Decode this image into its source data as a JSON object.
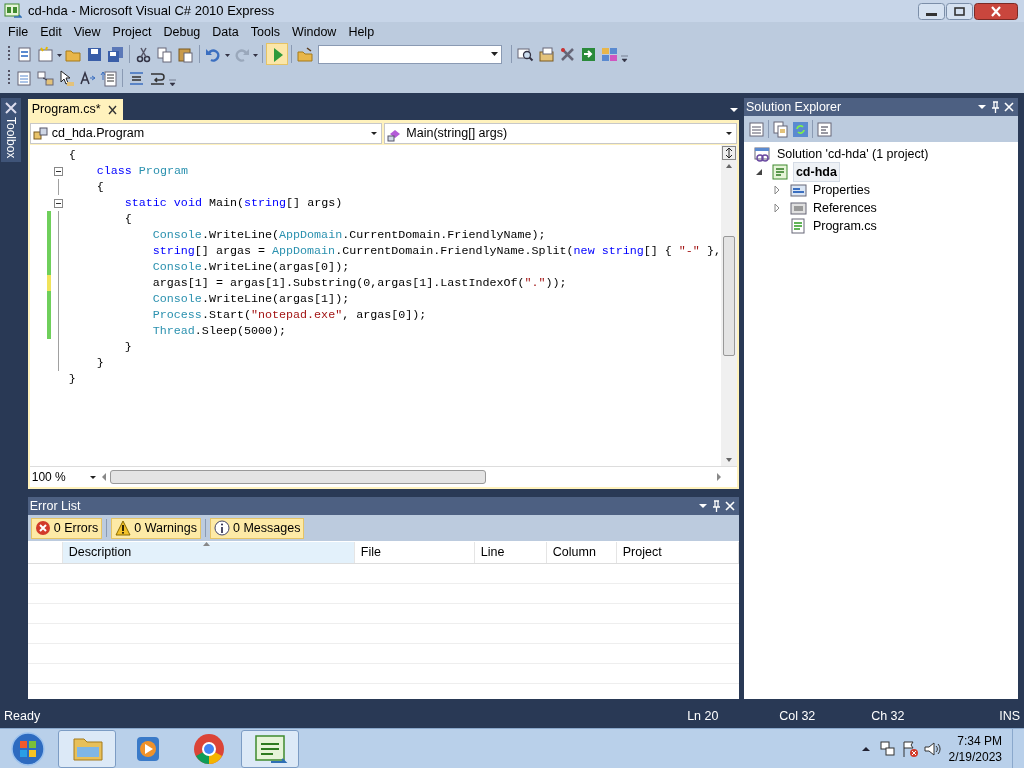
{
  "window": {
    "title": "cd-hda - Microsoft Visual C# 2010 Express"
  },
  "menu": [
    "File",
    "Edit",
    "View",
    "Project",
    "Debug",
    "Data",
    "Tools",
    "Window",
    "Help"
  ],
  "toolbox_tab": "Toolbox",
  "editor": {
    "tabs": [
      {
        "label": "Program.cs*",
        "selected": true
      }
    ],
    "type_dropdown": "cd_hda.Program",
    "member_dropdown": "Main(string[] args)",
    "lines": [
      {
        "modified": false,
        "fold": false,
        "tokens": [
          {
            "kind": "plain",
            "text": "{"
          }
        ],
        "children": [
          {
            "modified": false,
            "fold": true,
            "tokens": [
              {
                "kind": "keyword",
                "text": "class"
              },
              {
                "kind": "type",
                "text": " Program"
              }
            ]
          },
          {
            "modified": false,
            "fold": false,
            "tokens": [
              {
                "kind": "plain",
                "text": "{"
              }
            ],
            "children": [
              {
                "modified": false,
                "fold": true,
                "tokens": [
                  {
                    "kind": "keyword",
                    "text": "static void"
                  },
                  {
                    "kind": "plain",
                    "text": " Main("
                  },
                  {
                    "kind": "keyword",
                    "text": "string"
                  },
                  {
                    "kind": "plain",
                    "text": "[] args)"
                  }
                ]
              },
              {
                "modified": true,
                "saved": true,
                "fold": false,
                "tokens": [
                  {
                    "kind": "plain",
                    "text": "{"
                  }
                ],
                "children": [
                  {
                    "modified": true,
                    "saved": true,
                    "fold": false,
                    "tokens": [
                      {
                        "kind": "type",
                        "text": "Console"
                      },
                      {
                        "kind": "plain",
                        "text": ".WriteLine("
                      },
                      {
                        "kind": "type",
                        "text": "AppDomain"
                      },
                      {
                        "kind": "plain",
                        "text": ".CurrentDomain.FriendlyName);"
                      }
                    ]
                  },
                  {
                    "modified": true,
                    "saved": true,
                    "fold": false,
                    "tokens": [
                      {
                        "kind": "keyword",
                        "text": "string"
                      },
                      {
                        "kind": "plain",
                        "text": "[] argas = "
                      },
                      {
                        "kind": "type",
                        "text": "AppDomain"
                      },
                      {
                        "kind": "plain",
                        "text": ".CurrentDomain.FriendlyName.Split("
                      },
                      {
                        "kind": "keyword",
                        "text": "new string"
                      },
                      {
                        "kind": "plain",
                        "text": "[] { "
                      },
                      {
                        "kind": "string",
                        "text": "\"-\""
                      },
                      {
                        "kind": "plain",
                        "text": " },"
                      }
                    ]
                  },
                  {
                    "modified": true,
                    "saved": true,
                    "fold": false,
                    "tokens": [
                      {
                        "kind": "type",
                        "text": "Console"
                      },
                      {
                        "kind": "plain",
                        "text": ".WriteLine(argas[0]);"
                      }
                    ]
                  },
                  {
                    "modified": true,
                    "saved": false,
                    "fold": false,
                    "tokens": [
                      {
                        "kind": "plain",
                        "text": "argas[1] = argas[1].Substring(0,argas[1].LastIndexOf("
                      },
                      {
                        "kind": "string",
                        "text": "\".\""
                      },
                      {
                        "kind": "plain",
                        "text": "));"
                      }
                    ]
                  },
                  {
                    "modified": true,
                    "saved": true,
                    "fold": false,
                    "tokens": [
                      {
                        "kind": "type",
                        "text": "Console"
                      },
                      {
                        "kind": "plain",
                        "text": ".WriteLine(argas[1]);"
                      }
                    ]
                  },
                  {
                    "modified": true,
                    "saved": true,
                    "fold": false,
                    "tokens": [
                      {
                        "kind": "type",
                        "text": "Process"
                      },
                      {
                        "kind": "plain",
                        "text": ".Start("
                      },
                      {
                        "kind": "string",
                        "text": "\"notepad.exe\""
                      },
                      {
                        "kind": "plain",
                        "text": ", argas[0]);"
                      }
                    ]
                  },
                  {
                    "modified": true,
                    "saved": true,
                    "fold": false,
                    "tokens": [
                      {
                        "kind": "type",
                        "text": "Thread"
                      },
                      {
                        "kind": "plain",
                        "text": ".Sleep(5000);"
                      }
                    ]
                  }
                ]
              },
              {
                "modified": false,
                "fold": false,
                "tokens": [
                  {
                    "kind": "plain",
                    "text": "}"
                  }
                ]
              }
            ]
          },
          {
            "modified": false,
            "fold": false,
            "tokens": [
              {
                "kind": "plain",
                "text": "}"
              }
            ]
          }
        ]
      },
      {
        "modified": false,
        "fold": false,
        "tokens": [
          {
            "kind": "plain",
            "text": "}"
          }
        ]
      }
    ],
    "zoom": "100 %"
  },
  "error_list": {
    "title": "Error List",
    "filters": [
      {
        "kind": "error",
        "label": "0 Errors",
        "on": true
      },
      {
        "kind": "warning",
        "label": "0 Warnings",
        "on": true
      },
      {
        "kind": "info",
        "label": "0 Messages",
        "on": true
      }
    ],
    "columns": [
      "Description",
      "File",
      "Line",
      "Column",
      "Project"
    ]
  },
  "solution_explorer": {
    "title": "Solution Explorer",
    "tree": [
      {
        "kind": "solution",
        "label": "Solution 'cd-hda' (1 project)",
        "children": [
          {
            "kind": "project",
            "label": "cd-hda",
            "selected": true,
            "expanded": true,
            "children": [
              {
                "kind": "properties",
                "label": "Properties",
                "selected": false,
                "expanded": false
              },
              {
                "kind": "references",
                "label": "References",
                "selected": false,
                "expanded": false
              },
              {
                "kind": "file",
                "label": "Program.cs",
                "selected": false
              }
            ]
          }
        ]
      }
    ]
  },
  "status_bar": {
    "message": "Ready",
    "line": "Ln 20",
    "column": "Col 32",
    "char": "Ch 32",
    "mode": "INS"
  },
  "taskbar": {
    "apps": [
      {
        "kind": "explorer",
        "active": true
      },
      {
        "kind": "media",
        "active": false
      },
      {
        "kind": "browser",
        "active": false
      },
      {
        "kind": "csharp",
        "active": true
      }
    ],
    "time": "7:34 PM",
    "date": "2/19/2023"
  }
}
